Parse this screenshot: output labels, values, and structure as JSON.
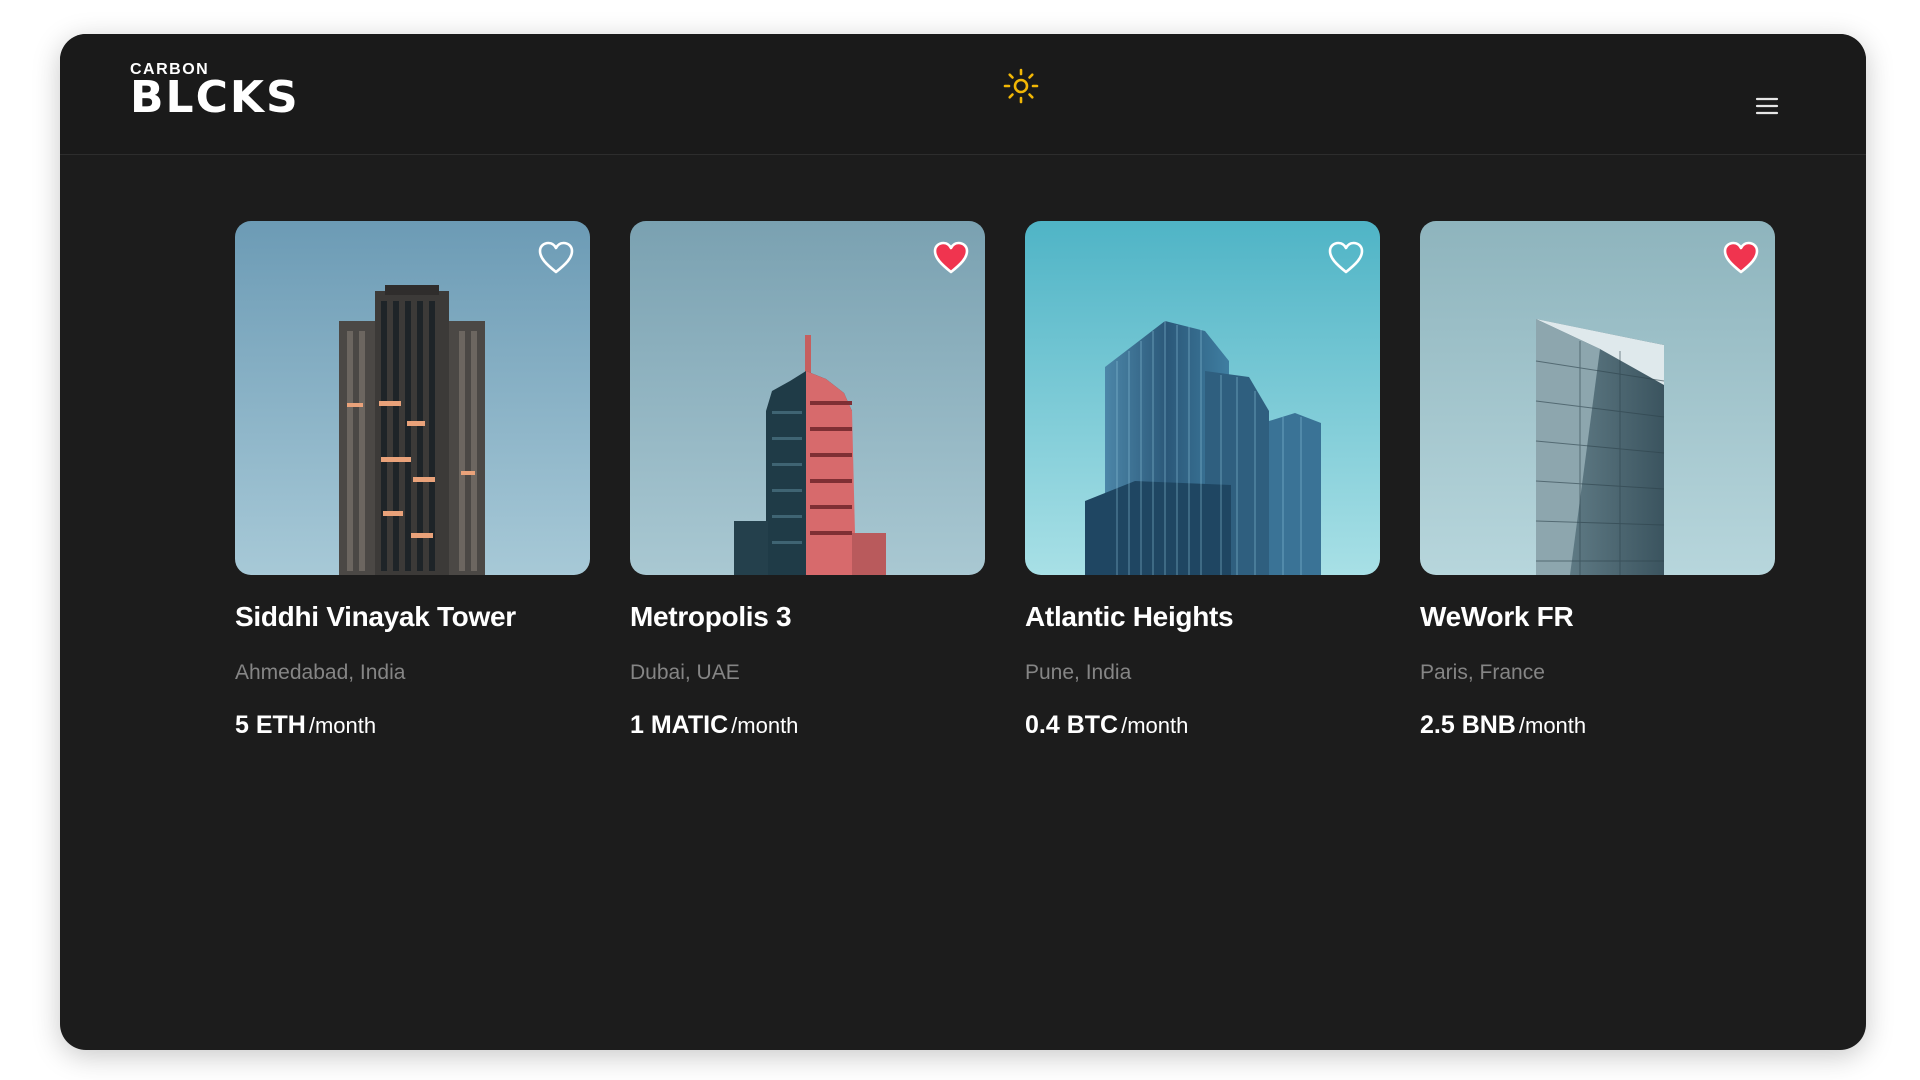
{
  "header": {
    "logo_top": "CARBON",
    "logo_main": "BLCKS",
    "theme_icon": "sun-icon",
    "menu_icon": "hamburger-menu-icon"
  },
  "colors": {
    "background": "#1c1c1c",
    "favorite_active": "#f0344f",
    "sun": "#f2b705"
  },
  "properties": [
    {
      "title": "Siddhi Vinayak Tower",
      "location": "Ahmedabad, India",
      "price": "5 ETH",
      "period": "/month",
      "favorited": false
    },
    {
      "title": "Metropolis 3",
      "location": "Dubai, UAE",
      "price": "1 MATIC",
      "period": "/month",
      "favorited": true
    },
    {
      "title": "Atlantic Heights",
      "location": "Pune, India",
      "price": "0.4 BTC",
      "period": "/month",
      "favorited": false
    },
    {
      "title": "WeWork FR",
      "location": "Paris, France",
      "price": "2.5 BNB",
      "period": "/month",
      "favorited": true
    }
  ]
}
